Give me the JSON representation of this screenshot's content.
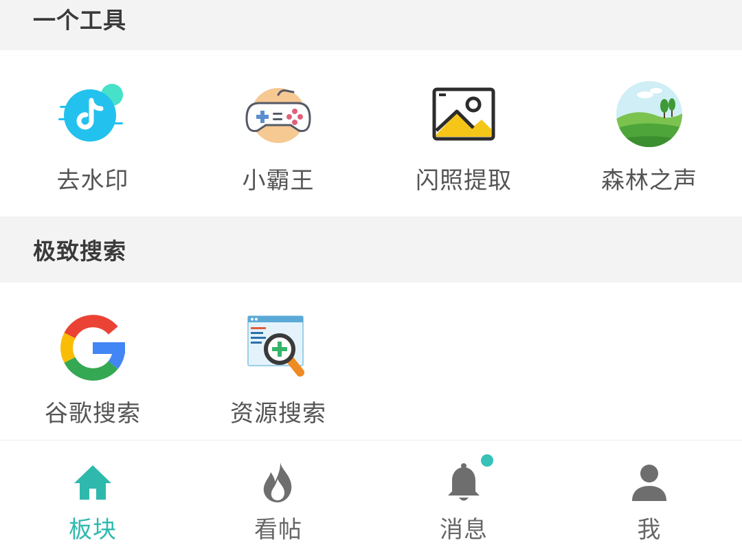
{
  "sections": [
    {
      "title": "一个工具",
      "items": [
        {
          "label": "去水印",
          "icon": "tiktok-logo-icon"
        },
        {
          "label": "小霸王",
          "icon": "gamepad-icon"
        },
        {
          "label": "闪照提取",
          "icon": "image-icon"
        },
        {
          "label": "森林之声",
          "icon": "forest-landscape-icon"
        }
      ]
    },
    {
      "title": "极致搜索",
      "items": [
        {
          "label": "谷歌搜索",
          "icon": "google-logo-icon"
        },
        {
          "label": "资源搜索",
          "icon": "web-search-icon"
        }
      ]
    }
  ],
  "tabbar": {
    "active": 0,
    "accent_color": "#2fb9ad",
    "items": [
      {
        "label": "板块",
        "icon": "home-icon"
      },
      {
        "label": "看帖",
        "icon": "flame-icon"
      },
      {
        "label": "消息",
        "icon": "bell-icon",
        "has_badge": true
      },
      {
        "label": "我",
        "icon": "person-icon"
      }
    ]
  }
}
